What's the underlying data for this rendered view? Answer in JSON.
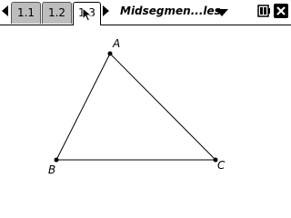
{
  "tabs": [
    {
      "label": "1.1"
    },
    {
      "label": "1.2"
    },
    {
      "label": "1.3",
      "active": true
    }
  ],
  "document": {
    "title": "Midsegmen...les"
  },
  "icons": {
    "nav_left": "left-triangle-icon",
    "nav_right": "right-triangle-icon",
    "document_menu": "down-triangle-icon",
    "battery": "battery-icon",
    "close": "close-icon",
    "cursor": "pointer-cursor-icon"
  },
  "geometry": {
    "vertices": [
      {
        "label": "A"
      },
      {
        "label": "B"
      },
      {
        "label": "C"
      }
    ]
  },
  "colors": {
    "tab_inactive": "#bdbdbd",
    "tab_active": "#ffffff",
    "ink": "#000000"
  }
}
